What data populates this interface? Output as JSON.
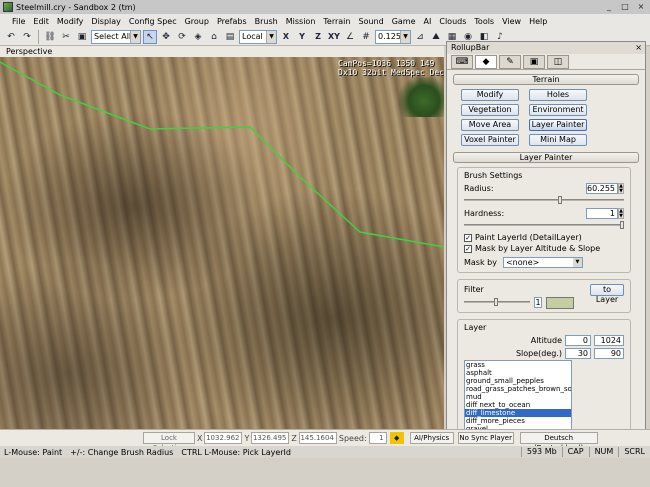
{
  "window": {
    "title": "Steelmill.cry - Sandbox 2 (tm)",
    "buttons": [
      "_",
      "□",
      "×"
    ]
  },
  "menu": [
    "File",
    "Edit",
    "Modify",
    "Display",
    "Config Spec",
    "Group",
    "Prefabs",
    "Brush",
    "Mission",
    "Terrain",
    "Sound",
    "Game",
    "AI",
    "Clouds",
    "Tools",
    "View",
    "Help"
  ],
  "toolbar": {
    "select_all": "Select All",
    "coord_system": "Local",
    "axes": [
      "X",
      "Y",
      "Z",
      "XY"
    ],
    "grid_value": "0.125"
  },
  "viewport": {
    "label": "Perspective",
    "overlay_line1": "CamPos=1036 1350 149",
    "overlay_line2": "Dx10 32bit MedSpec Dec"
  },
  "rollup": {
    "title": "RollupBar",
    "close": "×",
    "terrain_header": "Terrain",
    "terrain_buttons": [
      "Modify",
      "Holes",
      "Vegetation",
      "Environment",
      "Move Area",
      "Layer Painter",
      "Voxel Painter",
      "Mini Map"
    ],
    "active_button_index": 5,
    "layer_painter_header": "Layer Painter",
    "brush_settings": "Brush Settings",
    "radius_label": "Radius:",
    "radius_value": "60.255",
    "radius_level": 0.6,
    "hardness_label": "Hardness:",
    "hardness_value": "1",
    "hardness_level": 1.0,
    "paint_layerid": "Paint LayerId (DetailLayer)",
    "mask_by_altitude": "Mask by Layer Altitude & Slope",
    "mask_by_label": "Mask by",
    "mask_by_value": "<none>",
    "filter_label": "Filter",
    "to_layer": "to Layer",
    "filter_value": "1",
    "layer_label": "Layer",
    "altitude_label": "Altitude",
    "altitude_min": "0",
    "altitude_max": "1024",
    "slope_label": "Slope(deg.)",
    "slope_min": "30",
    "slope_max": "90",
    "layers": [
      "grass",
      "asphalt",
      "ground_small_pepples",
      "road_grass_patches_brown_soil",
      "mud",
      "diff next_to_ocean",
      "diff_limestone",
      "diff_more_pieces",
      "gravel"
    ],
    "selected_layer_index": 6
  },
  "status": {
    "lock_selection": "Lock Selection",
    "x_label": "X",
    "x_value": "1032.962",
    "y_label": "Y",
    "y_value": "1326.495",
    "z_label": "Z",
    "z_value": "145.1604",
    "speed_label": "Speed:",
    "speed_value": "1",
    "ai_physics": "AI/Physics",
    "no_sync": "No Sync Player",
    "language": "Deutsch (Deutschland)",
    "hint1": "L-Mouse: Paint",
    "hint2": "+/-: Change Brush Radius",
    "hint3": "CTRL L-Mouse: Pick LayerId",
    "memory": "593 Mb",
    "cap": "CAP",
    "num": "NUM",
    "scrl": "SCRL"
  },
  "colors": {
    "selection": "#316ac5",
    "terrain_line": "#3fd13f"
  }
}
